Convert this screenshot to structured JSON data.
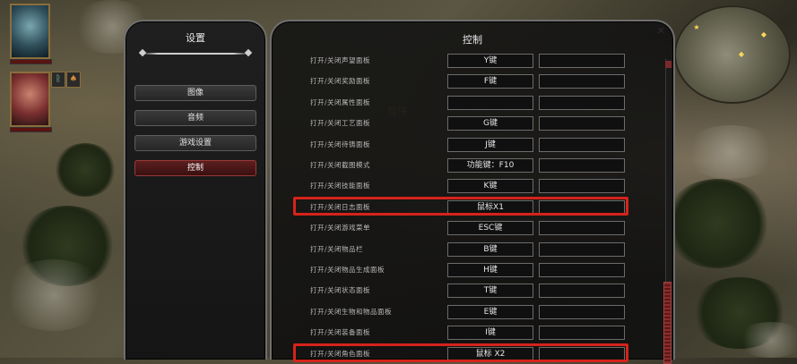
{
  "settings": {
    "title": "设置",
    "menu": [
      {
        "label": "图像",
        "active": false
      },
      {
        "label": "音频",
        "active": false
      },
      {
        "label": "游戏设置",
        "active": false
      },
      {
        "label": "控制",
        "active": true
      }
    ]
  },
  "controls": {
    "title": "控制",
    "rows": [
      {
        "action": "打开/关闭声望面板",
        "primary": "Y键",
        "secondary": "",
        "highlighted": false
      },
      {
        "action": "打开/关闭奖励面板",
        "primary": "F键",
        "secondary": "",
        "highlighted": false
      },
      {
        "action": "打开/关闭属性面板",
        "primary": "",
        "secondary": "",
        "highlighted": false
      },
      {
        "action": "打开/关闭工艺面板",
        "primary": "G键",
        "secondary": "",
        "highlighted": false
      },
      {
        "action": "打开/关闭待铸面板",
        "primary": "J键",
        "secondary": "",
        "highlighted": false
      },
      {
        "action": "打开/关闭截图模式",
        "primary": "功能键：F10",
        "secondary": "",
        "highlighted": false
      },
      {
        "action": "打开/关闭技能面板",
        "primary": "K键",
        "secondary": "",
        "highlighted": false
      },
      {
        "action": "打开/关闭日志面板",
        "primary": "鼠标X1",
        "secondary": "",
        "highlighted": true
      },
      {
        "action": "打开/关闭游戏菜单",
        "primary": "ESC键",
        "secondary": "",
        "highlighted": false
      },
      {
        "action": "打开/关闭物品栏",
        "primary": "B键",
        "secondary": "",
        "highlighted": false
      },
      {
        "action": "打开/关闭物品生成面板",
        "primary": "H键",
        "secondary": "",
        "highlighted": false
      },
      {
        "action": "打开/关闭状态面板",
        "primary": "T键",
        "secondary": "",
        "highlighted": false
      },
      {
        "action": "打开/关闭生物和物品面板",
        "primary": "E键",
        "secondary": "",
        "highlighted": false
      },
      {
        "action": "打开/关闭装备面板",
        "primary": "I键",
        "secondary": "",
        "highlighted": false
      },
      {
        "action": "打开/关闭角色面板",
        "primary": "鼠标 X2",
        "secondary": "",
        "highlighted": true
      }
    ]
  },
  "hud": {
    "pause_text": "暂停",
    "close_glyph": "✕",
    "status_icons": [
      "ᚱ",
      "♠"
    ]
  },
  "colors": {
    "highlight": "#d6231b",
    "active_menu": "#5c1f1f",
    "panel_border": "#6f6f6f"
  },
  "icons": [
    "close-icon",
    "scroll-up-icon",
    "portrait-icon",
    "minimap"
  ]
}
